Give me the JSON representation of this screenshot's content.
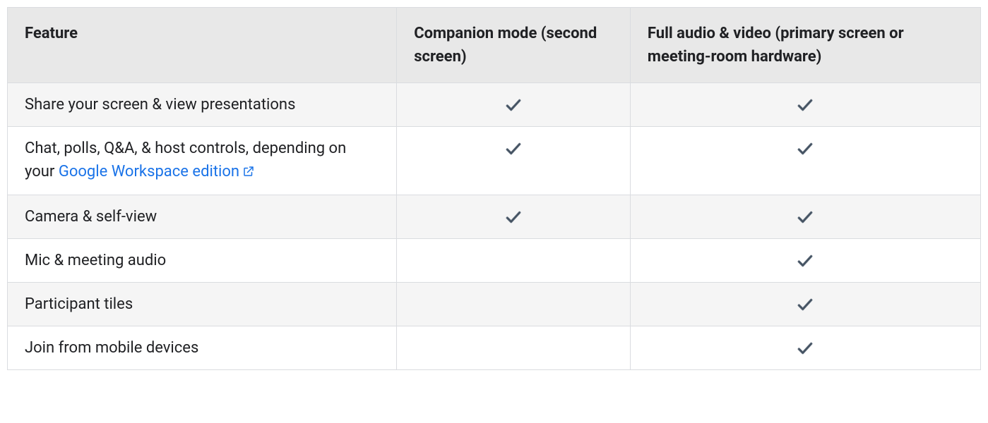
{
  "table": {
    "headers": {
      "feature": "Feature",
      "companion": "Companion mode (second screen)",
      "full": "Full audio & video (primary screen or meeting-room hardware)"
    },
    "rows": [
      {
        "feature": "Share your screen & view presentations",
        "companion": true,
        "full": true
      },
      {
        "feature_prefix": "Chat, polls, Q&A, & host controls, depending on your ",
        "link_text": "Google Workspace edition",
        "companion": true,
        "full": true
      },
      {
        "feature": "Camera & self-view",
        "companion": true,
        "full": true
      },
      {
        "feature": "Mic & meeting audio",
        "companion": false,
        "full": true
      },
      {
        "feature": "Participant tiles",
        "companion": false,
        "full": true
      },
      {
        "feature": "Join from mobile devices",
        "companion": false,
        "full": true
      }
    ],
    "check_glyph": "✔"
  }
}
